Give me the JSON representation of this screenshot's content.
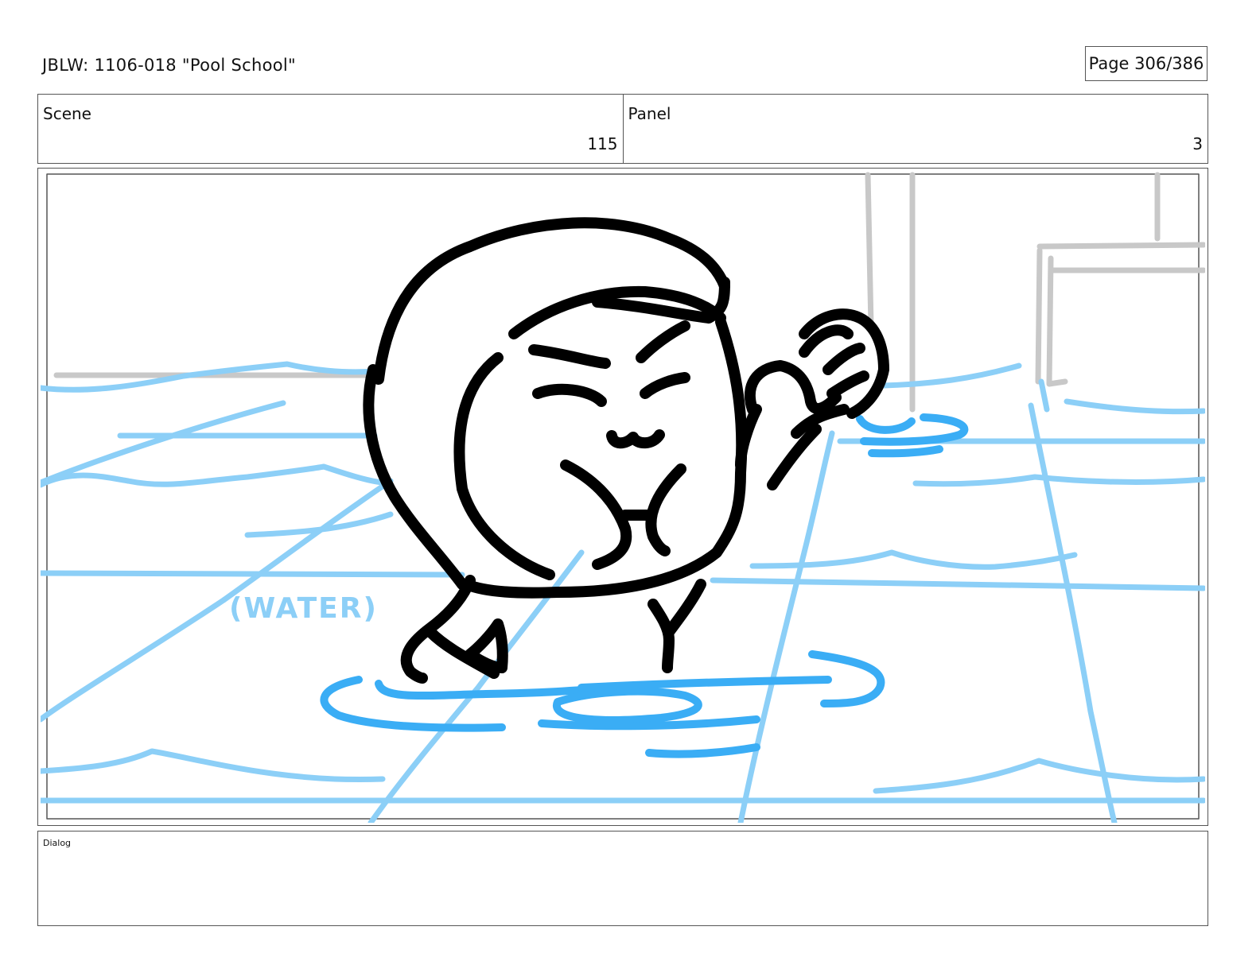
{
  "header": {
    "title": "JBLW: 1106-018 \"Pool School\"",
    "page": "Page 306/386"
  },
  "info": {
    "scene_label": "Scene",
    "scene_value": "115",
    "panel_label": "Panel",
    "panel_value": "3"
  },
  "frame": {
    "annotation": "(WATER)",
    "colors": {
      "ink": "#000000",
      "water_light": "#8ccff7",
      "water_dark": "#3aadf5",
      "background": "#c8c8c8",
      "note": "#8ccff7"
    }
  },
  "dialog": {
    "label": "Dialog"
  }
}
